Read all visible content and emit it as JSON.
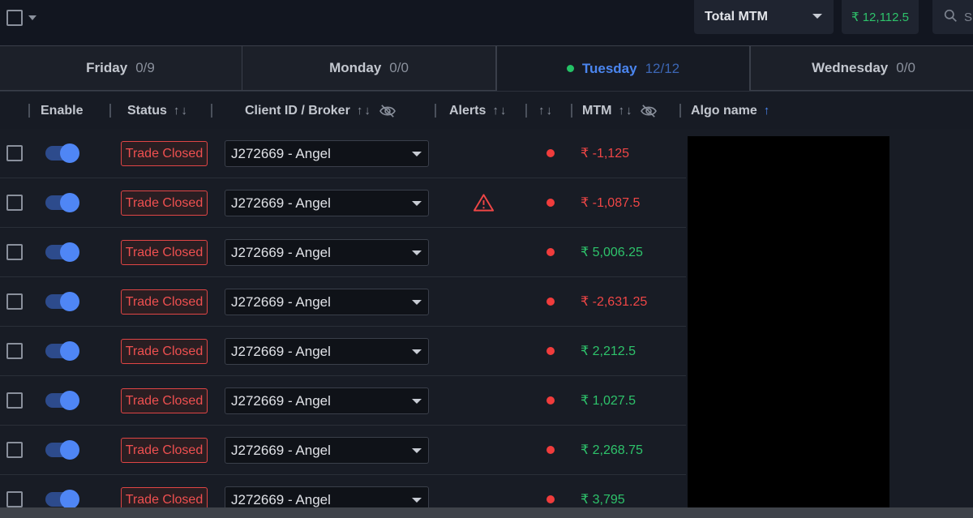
{
  "toolbar": {
    "mtm_select_label": "Total MTM",
    "total_mtm_value": "₹ 12,112.5",
    "search_placeholder": "S"
  },
  "tabs": [
    {
      "day": "Friday",
      "count": "0/9",
      "active": false
    },
    {
      "day": "Monday",
      "count": "0/0",
      "active": false
    },
    {
      "day": "Tuesday",
      "count": "12/12",
      "active": true
    },
    {
      "day": "Wednesday",
      "count": "0/0",
      "active": false
    }
  ],
  "columns": {
    "enable": "Enable",
    "status": "Status",
    "client": "Client ID / Broker",
    "alerts": "Alerts",
    "mtm": "MTM",
    "algo": "Algo name",
    "sort_arrows": "↑↓",
    "sort_up": "↑"
  },
  "rows": [
    {
      "status": "Trade Closed",
      "client": "J272669 - Angel",
      "alert": false,
      "mtm": "₹ -1,125",
      "mtm_sign": "neg"
    },
    {
      "status": "Trade Closed",
      "client": "J272669 - Angel",
      "alert": true,
      "mtm": "₹ -1,087.5",
      "mtm_sign": "neg"
    },
    {
      "status": "Trade Closed",
      "client": "J272669 - Angel",
      "alert": false,
      "mtm": "₹ 5,006.25",
      "mtm_sign": "pos"
    },
    {
      "status": "Trade Closed",
      "client": "J272669 - Angel",
      "alert": false,
      "mtm": "₹ -2,631.25",
      "mtm_sign": "neg"
    },
    {
      "status": "Trade Closed",
      "client": "J272669 - Angel",
      "alert": false,
      "mtm": "₹ 2,212.5",
      "mtm_sign": "pos"
    },
    {
      "status": "Trade Closed",
      "client": "J272669 - Angel",
      "alert": false,
      "mtm": "₹ 1,027.5",
      "mtm_sign": "pos"
    },
    {
      "status": "Trade Closed",
      "client": "J272669 - Angel",
      "alert": false,
      "mtm": "₹ 2,268.75",
      "mtm_sign": "pos"
    },
    {
      "status": "Trade Closed",
      "client": "J272669 - Angel",
      "alert": false,
      "mtm": "₹ 3,795",
      "mtm_sign": "pos"
    }
  ],
  "colors": {
    "accent": "#4b86f0",
    "positive": "#2ec36b",
    "negative": "#ef4646",
    "background": "#141820"
  }
}
